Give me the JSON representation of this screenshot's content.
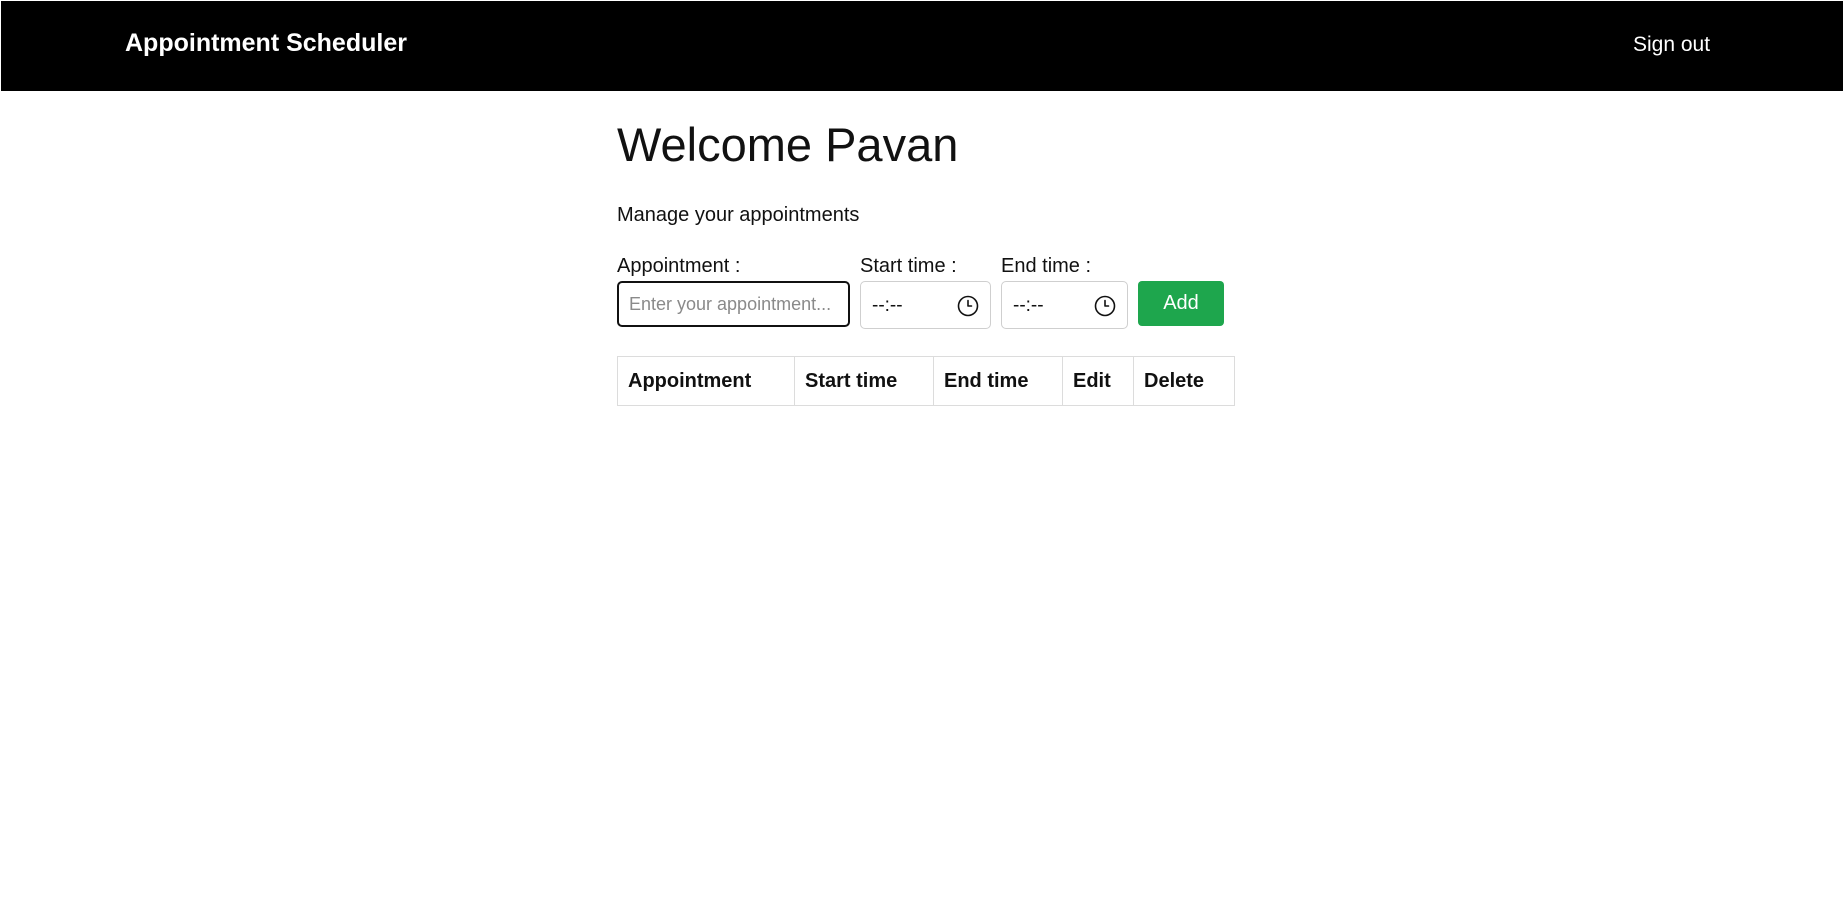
{
  "header": {
    "brand": "Appointment Scheduler",
    "sign_out": "Sign out"
  },
  "main": {
    "welcome": "Welcome Pavan",
    "subtitle": "Manage your appointments"
  },
  "form": {
    "appointment_label": "Appointment :",
    "appointment_value": "",
    "appointment_placeholder": "Enter your appointment...",
    "start_label": "Start time :",
    "start_value": "--:--",
    "end_label": "End time :",
    "end_value": "--:--",
    "add_button": "Add",
    "icons": {
      "time_picker": "clock-icon"
    }
  },
  "table": {
    "columns": [
      "Appointment",
      "Start time",
      "End time",
      "Edit",
      "Delete"
    ],
    "rows": []
  },
  "colors": {
    "navbar": "#000000",
    "add_button": "#1ea64d"
  }
}
